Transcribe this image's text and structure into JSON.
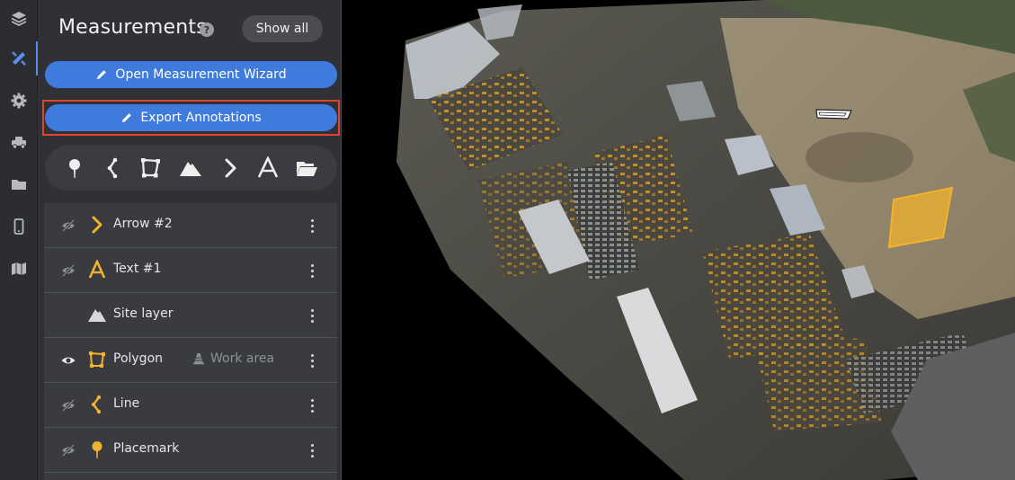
{
  "panel": {
    "title": "Measurements",
    "help_glyph": "?",
    "show_all_label": "Show all",
    "wizard_label": "Open Measurement Wizard",
    "export_label": "Export Annotations"
  },
  "rail": [
    {
      "icon": "layers-icon"
    },
    {
      "icon": "measure-tools-icon",
      "active": true
    },
    {
      "icon": "gear-icon"
    },
    {
      "icon": "vehicle-icon"
    },
    {
      "icon": "folder-icon"
    },
    {
      "icon": "mobile-icon"
    },
    {
      "icon": "map-icon"
    }
  ],
  "tools": [
    "placemark-icon",
    "line-icon",
    "polygon-icon",
    "volume-icon",
    "arrow-icon",
    "text-icon",
    "folder-open-icon"
  ],
  "list": [
    {
      "label": "Arrow #2",
      "visible": false,
      "type": "arrow"
    },
    {
      "label": "Text #1",
      "visible": false,
      "type": "text"
    },
    {
      "label": "Site layer",
      "visible": null,
      "type": "layer"
    },
    {
      "label": "Polygon",
      "visible": true,
      "type": "polygon",
      "layer": "Work area"
    },
    {
      "label": "Line",
      "visible": false,
      "type": "line"
    },
    {
      "label": "Placemark",
      "visible": false,
      "type": "placemark"
    }
  ],
  "colors": {
    "accent": "#3e7bdc",
    "annotation": "#f2b22e",
    "highlight": "#e0442c"
  }
}
